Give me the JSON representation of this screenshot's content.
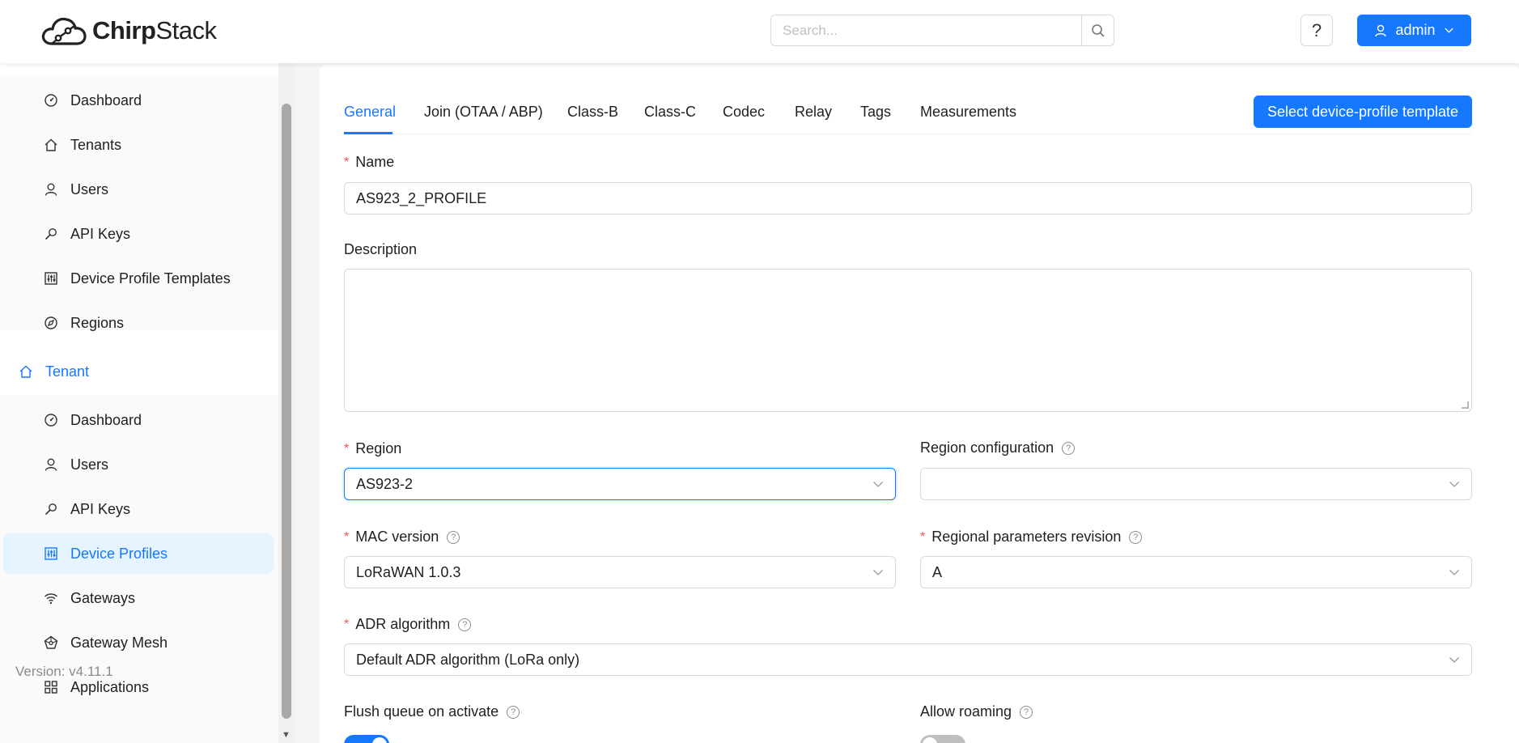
{
  "header": {
    "logo_text_bold": "Chirp",
    "logo_text_rest": "Stack",
    "search_placeholder": "Search...",
    "help_label": "?",
    "user_label": "admin"
  },
  "sidebar": {
    "admin_items": [
      {
        "label": "Dashboard",
        "icon": "dashboard-icon"
      },
      {
        "label": "Tenants",
        "icon": "home-icon"
      },
      {
        "label": "Users",
        "icon": "user-icon"
      },
      {
        "label": "API Keys",
        "icon": "key-icon"
      },
      {
        "label": "Device Profile Templates",
        "icon": "sliders-icon"
      },
      {
        "label": "Regions",
        "icon": "compass-icon"
      }
    ],
    "tenant_label": "Tenant",
    "tenant_items": [
      {
        "label": "Dashboard",
        "icon": "dashboard-icon"
      },
      {
        "label": "Users",
        "icon": "user-icon"
      },
      {
        "label": "API Keys",
        "icon": "key-icon"
      },
      {
        "label": "Device Profiles",
        "icon": "sliders-icon",
        "selected": true
      },
      {
        "label": "Gateways",
        "icon": "wifi-icon"
      },
      {
        "label": "Gateway Mesh",
        "icon": "mesh-icon"
      },
      {
        "label": "Applications",
        "icon": "grid-icon"
      }
    ],
    "version": "Version: v4.11.1"
  },
  "tabs": [
    "General",
    "Join (OTAA / ABP)",
    "Class-B",
    "Class-C",
    "Codec",
    "Relay",
    "Tags",
    "Measurements"
  ],
  "active_tab": "General",
  "template_button": "Select device-profile template",
  "form": {
    "name_label": "Name",
    "name_value": "AS923_2_PROFILE",
    "description_label": "Description",
    "description_value": "",
    "region_label": "Region",
    "region_value": "AS923-2",
    "region_config_label": "Region configuration",
    "region_config_value": "",
    "mac_label": "MAC version",
    "mac_value": "LoRaWAN 1.0.3",
    "rp_label": "Regional parameters revision",
    "rp_value": "A",
    "adr_label": "ADR algorithm",
    "adr_value": "Default ADR algorithm (LoRa only)",
    "flush_label": "Flush queue on activate",
    "flush_on": true,
    "roaming_label": "Allow roaming",
    "roaming_on": false
  },
  "colors": {
    "accent": "#1677ff",
    "required": "#ff4d4f"
  }
}
